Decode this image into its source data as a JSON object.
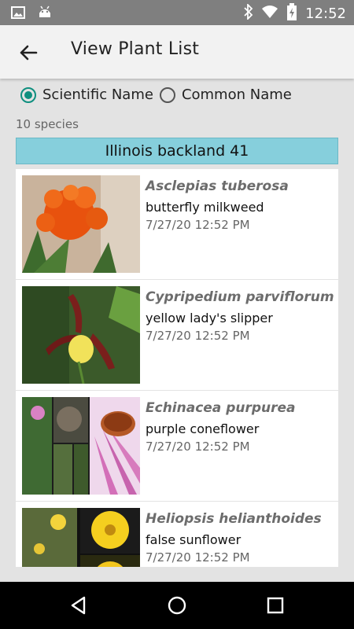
{
  "status": {
    "time": "12:52"
  },
  "appbar": {
    "title": "View Plant List"
  },
  "sort": {
    "scientific_label": "Scientific Name",
    "common_label": "Common Name",
    "selected": "scientific"
  },
  "count_text": "10 species",
  "group_title": "Illinois backland 41",
  "plants": [
    {
      "scientific": "Asclepias tuberosa",
      "common": "butterfly milkweed",
      "date": "7/27/20 12:52 PM"
    },
    {
      "scientific": "Cypripedium parviflorum",
      "common": "yellow lady's slipper",
      "date": "7/27/20 12:52 PM"
    },
    {
      "scientific": "Echinacea purpurea",
      "common": "purple coneflower",
      "date": "7/27/20 12:52 PM"
    },
    {
      "scientific": "Heliopsis helianthoides",
      "common": "false sunflower",
      "date": "7/27/20 12:52 PM"
    }
  ],
  "colors": {
    "accent": "#0f8f7f",
    "header": "#86cfdc",
    "statusbar": "#7f7f7f"
  },
  "icons": {
    "status_left": [
      "image-icon",
      "android-icon"
    ],
    "status_right": [
      "bluetooth-icon",
      "wifi-icon",
      "battery-icon"
    ],
    "nav": [
      "back-nav-icon",
      "home-nav-icon",
      "recents-nav-icon"
    ]
  }
}
